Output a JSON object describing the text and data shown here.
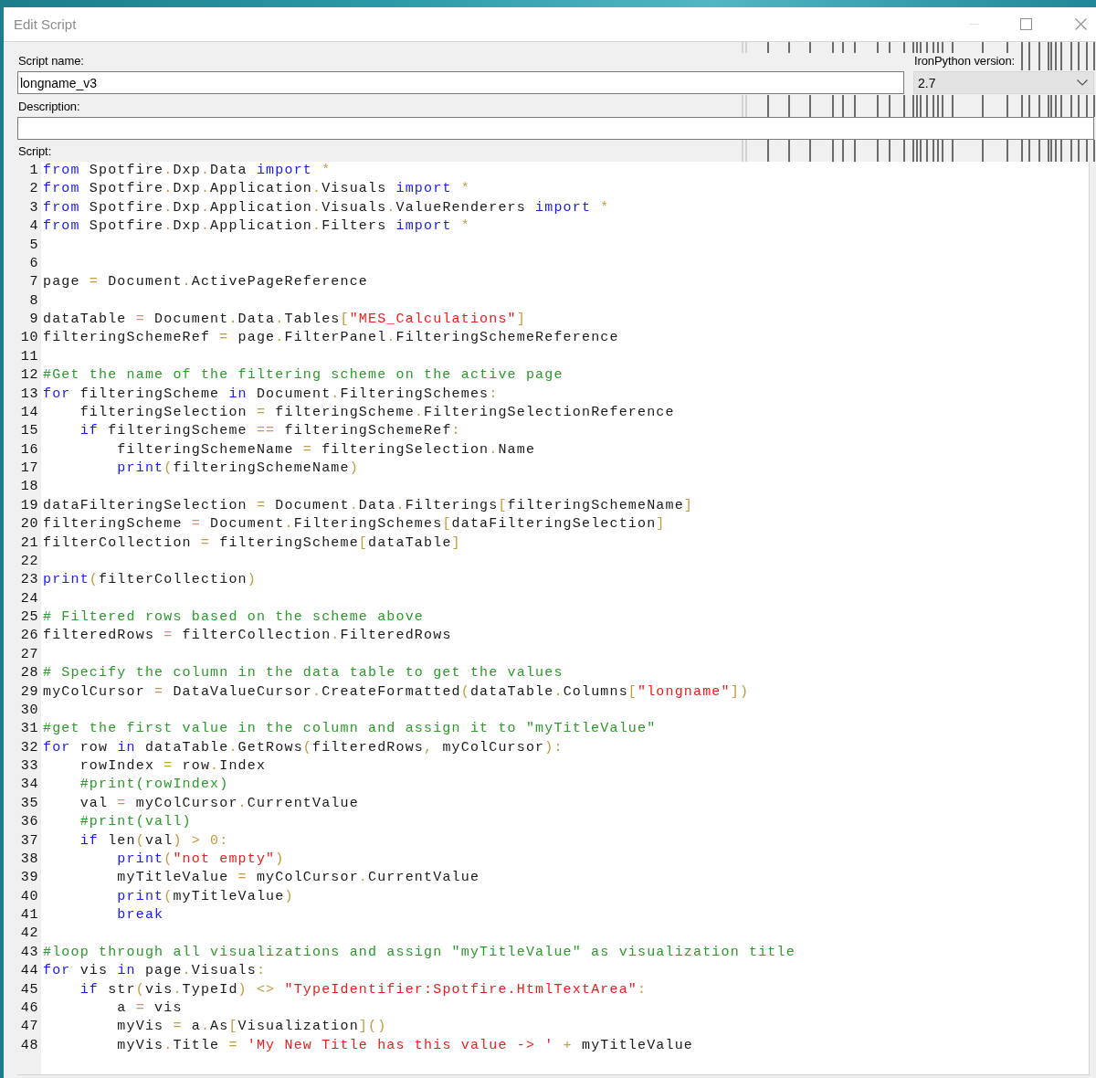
{
  "window": {
    "title": "Edit Script",
    "controls": [
      {
        "kind": "minimize",
        "disabled": true
      },
      {
        "kind": "maximize",
        "disabled": false
      },
      {
        "kind": "close",
        "disabled": false
      }
    ]
  },
  "script_name": {
    "label": "Script name:",
    "value": "longname_v3"
  },
  "ironpython_version": {
    "label": "IronPython version:",
    "value": "2.7"
  },
  "description": {
    "label": "Description:"
  },
  "script": {
    "label": "Script:",
    "lines": [
      {
        "number": "1",
        "tokens": [
          {
            "kind": "keyword",
            "text": "from"
          },
          {
            "kind": "plain",
            "text": " Spotfire"
          },
          {
            "kind": "operator",
            "text": "."
          },
          {
            "kind": "plain",
            "text": "Dxp"
          },
          {
            "kind": "operator",
            "text": "."
          },
          {
            "kind": "plain",
            "text": "Data "
          },
          {
            "kind": "keyword",
            "text": "import"
          },
          {
            "kind": "operator",
            "text": " *"
          }
        ]
      },
      {
        "number": "2",
        "tokens": [
          {
            "kind": "keyword",
            "text": "from"
          },
          {
            "kind": "plain",
            "text": " Spotfire"
          },
          {
            "kind": "operator",
            "text": "."
          },
          {
            "kind": "plain",
            "text": "Dxp"
          },
          {
            "kind": "operator",
            "text": "."
          },
          {
            "kind": "plain",
            "text": "Application"
          },
          {
            "kind": "operator",
            "text": "."
          },
          {
            "kind": "plain",
            "text": "Visuals "
          },
          {
            "kind": "keyword",
            "text": "import"
          },
          {
            "kind": "operator",
            "text": " *"
          }
        ]
      },
      {
        "number": "3",
        "tokens": [
          {
            "kind": "keyword",
            "text": "from"
          },
          {
            "kind": "plain",
            "text": " Spotfire"
          },
          {
            "kind": "operator",
            "text": "."
          },
          {
            "kind": "plain",
            "text": "Dxp"
          },
          {
            "kind": "operator",
            "text": "."
          },
          {
            "kind": "plain",
            "text": "Application"
          },
          {
            "kind": "operator",
            "text": "."
          },
          {
            "kind": "plain",
            "text": "Visuals"
          },
          {
            "kind": "operator",
            "text": "."
          },
          {
            "kind": "plain",
            "text": "ValueRenderers "
          },
          {
            "kind": "keyword",
            "text": "import"
          },
          {
            "kind": "operator",
            "text": " *"
          }
        ]
      },
      {
        "number": "4",
        "tokens": [
          {
            "kind": "keyword",
            "text": "from"
          },
          {
            "kind": "plain",
            "text": " Spotfire"
          },
          {
            "kind": "operator",
            "text": "."
          },
          {
            "kind": "plain",
            "text": "Dxp"
          },
          {
            "kind": "operator",
            "text": "."
          },
          {
            "kind": "plain",
            "text": "Application"
          },
          {
            "kind": "operator",
            "text": "."
          },
          {
            "kind": "plain",
            "text": "Filters "
          },
          {
            "kind": "keyword",
            "text": "import"
          },
          {
            "kind": "operator",
            "text": " *"
          }
        ]
      },
      {
        "number": "5"
      },
      {
        "number": "6"
      },
      {
        "number": "7",
        "tokens": [
          {
            "kind": "plain",
            "text": "page"
          },
          {
            "kind": "operator",
            "text": " = "
          },
          {
            "kind": "plain",
            "text": "Document"
          },
          {
            "kind": "operator",
            "text": "."
          },
          {
            "kind": "plain",
            "text": "ActivePageReference"
          }
        ]
      },
      {
        "number": "8"
      },
      {
        "number": "9",
        "tokens": [
          {
            "kind": "plain",
            "text": "dataTable"
          },
          {
            "kind": "operator",
            "text": " = "
          },
          {
            "kind": "plain",
            "text": "Document"
          },
          {
            "kind": "operator",
            "text": "."
          },
          {
            "kind": "plain",
            "text": "Data"
          },
          {
            "kind": "operator",
            "text": "."
          },
          {
            "kind": "plain",
            "text": "Tables"
          },
          {
            "kind": "operator",
            "text": "["
          },
          {
            "kind": "string",
            "text": "\"MES_Calculations\""
          },
          {
            "kind": "operator",
            "text": "]"
          }
        ]
      },
      {
        "number": "10",
        "tokens": [
          {
            "kind": "plain",
            "text": "filteringSchemeRef"
          },
          {
            "kind": "operator",
            "text": " = "
          },
          {
            "kind": "plain",
            "text": "page"
          },
          {
            "kind": "operator",
            "text": "."
          },
          {
            "kind": "plain",
            "text": "FilterPanel"
          },
          {
            "kind": "operator",
            "text": "."
          },
          {
            "kind": "plain",
            "text": "FilteringSchemeReference"
          }
        ]
      },
      {
        "number": "11"
      },
      {
        "number": "12",
        "tokens": [
          {
            "kind": "comment",
            "text": "#Get the name of the filtering scheme on the active page"
          }
        ]
      },
      {
        "number": "13",
        "tokens": [
          {
            "kind": "keyword",
            "text": "for"
          },
          {
            "kind": "plain",
            "text": " filteringScheme "
          },
          {
            "kind": "keyword",
            "text": "in"
          },
          {
            "kind": "plain",
            "text": " Document"
          },
          {
            "kind": "operator",
            "text": "."
          },
          {
            "kind": "plain",
            "text": "FilteringSchemes"
          },
          {
            "kind": "operator",
            "text": ":"
          }
        ]
      },
      {
        "number": "14",
        "tokens": [
          {
            "kind": "plain",
            "text": "    filteringSelection"
          },
          {
            "kind": "operator",
            "text": " = "
          },
          {
            "kind": "plain",
            "text": "filteringScheme"
          },
          {
            "kind": "operator",
            "text": "."
          },
          {
            "kind": "plain",
            "text": "FilteringSelectionReference"
          }
        ]
      },
      {
        "number": "15",
        "tokens": [
          {
            "kind": "keyword",
            "text": "    if"
          },
          {
            "kind": "plain",
            "text": " filteringScheme"
          },
          {
            "kind": "operator",
            "text": " == "
          },
          {
            "kind": "plain",
            "text": "filteringSchemeRef"
          },
          {
            "kind": "operator",
            "text": ":"
          }
        ]
      },
      {
        "number": "16",
        "tokens": [
          {
            "kind": "plain",
            "text": "        filteringSchemeName"
          },
          {
            "kind": "operator",
            "text": " = "
          },
          {
            "kind": "plain",
            "text": "filteringSelection"
          },
          {
            "kind": "operator",
            "text": "."
          },
          {
            "kind": "plain",
            "text": "Name"
          }
        ]
      },
      {
        "number": "17",
        "tokens": [
          {
            "kind": "keyword",
            "text": "        print"
          },
          {
            "kind": "operator",
            "text": "("
          },
          {
            "kind": "plain",
            "text": "filteringSchemeName"
          },
          {
            "kind": "operator",
            "text": ")"
          }
        ]
      },
      {
        "number": "18"
      },
      {
        "number": "19",
        "tokens": [
          {
            "kind": "plain",
            "text": "dataFilteringSelection"
          },
          {
            "kind": "operator",
            "text": " = "
          },
          {
            "kind": "plain",
            "text": "Document"
          },
          {
            "kind": "operator",
            "text": "."
          },
          {
            "kind": "plain",
            "text": "Data"
          },
          {
            "kind": "operator",
            "text": "."
          },
          {
            "kind": "plain",
            "text": "Filterings"
          },
          {
            "kind": "operator",
            "text": "["
          },
          {
            "kind": "plain",
            "text": "filteringSchemeName"
          },
          {
            "kind": "operator",
            "text": "]"
          }
        ]
      },
      {
        "number": "20",
        "tokens": [
          {
            "kind": "plain",
            "text": "filteringScheme"
          },
          {
            "kind": "operator",
            "text": " = "
          },
          {
            "kind": "plain",
            "text": "Document"
          },
          {
            "kind": "operator",
            "text": "."
          },
          {
            "kind": "plain",
            "text": "FilteringSchemes"
          },
          {
            "kind": "operator",
            "text": "["
          },
          {
            "kind": "plain",
            "text": "dataFilteringSelection"
          },
          {
            "kind": "operator",
            "text": "]"
          }
        ]
      },
      {
        "number": "21",
        "tokens": [
          {
            "kind": "plain",
            "text": "filterCollection"
          },
          {
            "kind": "operator",
            "text": " = "
          },
          {
            "kind": "plain",
            "text": "filteringScheme"
          },
          {
            "kind": "operator",
            "text": "["
          },
          {
            "kind": "plain",
            "text": "dataTable"
          },
          {
            "kind": "operator",
            "text": "]"
          }
        ]
      },
      {
        "number": "22"
      },
      {
        "number": "23",
        "tokens": [
          {
            "kind": "keyword",
            "text": "print"
          },
          {
            "kind": "operator",
            "text": "("
          },
          {
            "kind": "plain",
            "text": "filterCollection"
          },
          {
            "kind": "operator",
            "text": ")"
          }
        ]
      },
      {
        "number": "24"
      },
      {
        "number": "25",
        "tokens": [
          {
            "kind": "comment",
            "text": "# Filtered rows based on the scheme above"
          }
        ]
      },
      {
        "number": "26",
        "tokens": [
          {
            "kind": "plain",
            "text": "filteredRows"
          },
          {
            "kind": "operator",
            "text": " = "
          },
          {
            "kind": "plain",
            "text": "filterCollection"
          },
          {
            "kind": "operator",
            "text": "."
          },
          {
            "kind": "plain",
            "text": "FilteredRows"
          }
        ]
      },
      {
        "number": "27"
      },
      {
        "number": "28",
        "tokens": [
          {
            "kind": "comment",
            "text": "# Specify the column in the data table to get the values"
          }
        ]
      },
      {
        "number": "29",
        "tokens": [
          {
            "kind": "plain",
            "text": "myColCursor"
          },
          {
            "kind": "operator",
            "text": " = "
          },
          {
            "kind": "plain",
            "text": "DataValueCursor"
          },
          {
            "kind": "operator",
            "text": "."
          },
          {
            "kind": "plain",
            "text": "CreateFormatted"
          },
          {
            "kind": "operator",
            "text": "("
          },
          {
            "kind": "plain",
            "text": "dataTable"
          },
          {
            "kind": "operator",
            "text": "."
          },
          {
            "kind": "plain",
            "text": "Columns"
          },
          {
            "kind": "operator",
            "text": "["
          },
          {
            "kind": "string",
            "text": "\"longname\""
          },
          {
            "kind": "operator",
            "text": "])"
          }
        ]
      },
      {
        "number": "30"
      },
      {
        "number": "31",
        "tokens": [
          {
            "kind": "comment",
            "text": "#get the first value in the column and assign it to \"myTitleValue\""
          }
        ]
      },
      {
        "number": "32",
        "tokens": [
          {
            "kind": "keyword",
            "text": "for"
          },
          {
            "kind": "plain",
            "text": " row "
          },
          {
            "kind": "keyword",
            "text": "in"
          },
          {
            "kind": "plain",
            "text": " dataTable"
          },
          {
            "kind": "operator",
            "text": "."
          },
          {
            "kind": "plain",
            "text": "GetRows"
          },
          {
            "kind": "operator",
            "text": "("
          },
          {
            "kind": "plain",
            "text": "filteredRows"
          },
          {
            "kind": "operator",
            "text": ", "
          },
          {
            "kind": "plain",
            "text": "myColCursor"
          },
          {
            "kind": "operator",
            "text": "):"
          }
        ]
      },
      {
        "number": "33",
        "tokens": [
          {
            "kind": "plain",
            "text": "    rowIndex"
          },
          {
            "kind": "operator",
            "text": " = "
          },
          {
            "kind": "plain",
            "text": "row"
          },
          {
            "kind": "operator",
            "text": "."
          },
          {
            "kind": "plain",
            "text": "Index"
          }
        ]
      },
      {
        "number": "34",
        "tokens": [
          {
            "kind": "comment",
            "text": "    #print(rowIndex)"
          }
        ]
      },
      {
        "number": "35",
        "tokens": [
          {
            "kind": "plain",
            "text": "    val"
          },
          {
            "kind": "operator",
            "text": " = "
          },
          {
            "kind": "plain",
            "text": "myColCursor"
          },
          {
            "kind": "operator",
            "text": "."
          },
          {
            "kind": "plain",
            "text": "CurrentValue"
          }
        ]
      },
      {
        "number": "36",
        "tokens": [
          {
            "kind": "comment",
            "text": "    #print(vall)"
          }
        ]
      },
      {
        "number": "37",
        "tokens": [
          {
            "kind": "keyword",
            "text": "    if"
          },
          {
            "kind": "plain",
            "text": " len"
          },
          {
            "kind": "operator",
            "text": "("
          },
          {
            "kind": "plain",
            "text": "val"
          },
          {
            "kind": "operator",
            "text": ") > 0:"
          }
        ]
      },
      {
        "number": "38",
        "tokens": [
          {
            "kind": "keyword",
            "text": "        print"
          },
          {
            "kind": "operator",
            "text": "("
          },
          {
            "kind": "string",
            "text": "\"not empty\""
          },
          {
            "kind": "operator",
            "text": ")"
          }
        ]
      },
      {
        "number": "39",
        "tokens": [
          {
            "kind": "plain",
            "text": "        myTitleValue"
          },
          {
            "kind": "operator",
            "text": " = "
          },
          {
            "kind": "plain",
            "text": "myColCursor"
          },
          {
            "kind": "operator",
            "text": "."
          },
          {
            "kind": "plain",
            "text": "CurrentValue"
          }
        ]
      },
      {
        "number": "40",
        "tokens": [
          {
            "kind": "keyword",
            "text": "        print"
          },
          {
            "kind": "operator",
            "text": "("
          },
          {
            "kind": "plain",
            "text": "myTitleValue"
          },
          {
            "kind": "operator",
            "text": ")"
          }
        ]
      },
      {
        "number": "41",
        "tokens": [
          {
            "kind": "keyword",
            "text": "        break"
          }
        ]
      },
      {
        "number": "42"
      },
      {
        "number": "43",
        "tokens": [
          {
            "kind": "comment",
            "text": "#loop through all visualizations and assign \"myTitleValue\" as visualization title"
          }
        ]
      },
      {
        "number": "44",
        "tokens": [
          {
            "kind": "keyword",
            "text": "for"
          },
          {
            "kind": "plain",
            "text": " vis "
          },
          {
            "kind": "keyword",
            "text": "in"
          },
          {
            "kind": "plain",
            "text": " page"
          },
          {
            "kind": "operator",
            "text": "."
          },
          {
            "kind": "plain",
            "text": "Visuals"
          },
          {
            "kind": "operator",
            "text": ":"
          }
        ]
      },
      {
        "number": "45",
        "tokens": [
          {
            "kind": "keyword",
            "text": "    if"
          },
          {
            "kind": "plain",
            "text": " str"
          },
          {
            "kind": "operator",
            "text": "("
          },
          {
            "kind": "plain",
            "text": "vis"
          },
          {
            "kind": "operator",
            "text": "."
          },
          {
            "kind": "plain",
            "text": "TypeId"
          },
          {
            "kind": "operator",
            "text": ") <> "
          },
          {
            "kind": "string",
            "text": "\"TypeIdentifier:Spotfire.HtmlTextArea\""
          },
          {
            "kind": "operator",
            "text": ":"
          }
        ]
      },
      {
        "number": "46",
        "tokens": [
          {
            "kind": "plain",
            "text": "        a"
          },
          {
            "kind": "operator",
            "text": " = "
          },
          {
            "kind": "plain",
            "text": "vis"
          }
        ]
      },
      {
        "number": "47",
        "tokens": [
          {
            "kind": "plain",
            "text": "        myVis"
          },
          {
            "kind": "operator",
            "text": " = "
          },
          {
            "kind": "plain",
            "text": "a"
          },
          {
            "kind": "operator",
            "text": "."
          },
          {
            "kind": "plain",
            "text": "As"
          },
          {
            "kind": "operator",
            "text": "["
          },
          {
            "kind": "plain",
            "text": "Visualization"
          },
          {
            "kind": "operator",
            "text": "]()"
          }
        ]
      },
      {
        "number": "48",
        "tokens": [
          {
            "kind": "plain",
            "text": "        myVis"
          },
          {
            "kind": "operator",
            "text": "."
          },
          {
            "kind": "plain",
            "text": "Title"
          },
          {
            "kind": "operator",
            "text": " = "
          },
          {
            "kind": "string",
            "text": "'My New Title has this value -> '"
          },
          {
            "kind": "operator",
            "text": " + "
          },
          {
            "kind": "plain",
            "text": "myTitleValue"
          }
        ]
      }
    ]
  }
}
